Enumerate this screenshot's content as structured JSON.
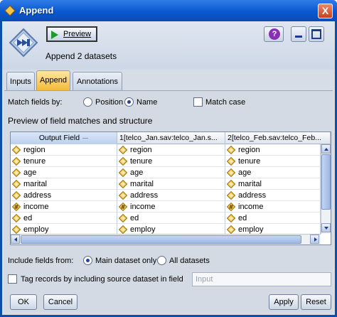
{
  "window": {
    "title": "Append",
    "close_label": "X"
  },
  "toolbar": {
    "preview_label": "Preview",
    "help_label": "?"
  },
  "subtitle": "Append 2 datasets",
  "tabs": [
    {
      "label": "Inputs",
      "active": false
    },
    {
      "label": "Append",
      "active": true
    },
    {
      "label": "Annotations",
      "active": false
    }
  ],
  "match_fields": {
    "label": "Match fields by:",
    "option_position": "Position",
    "option_name": "Name",
    "selected": "Name",
    "match_case_label": "Match case",
    "match_case_checked": false
  },
  "preview_heading": "Preview of field matches and structure",
  "grid": {
    "columns": [
      "Output Field",
      "1[telco_Jan.sav:telco_Jan.s...",
      "2[telco_Feb.sav:telco_Feb..."
    ],
    "rows": [
      {
        "type": "nominal",
        "cells": [
          "region",
          "region",
          "region"
        ]
      },
      {
        "type": "nominal",
        "cells": [
          "tenure",
          "tenure",
          "tenure"
        ]
      },
      {
        "type": "nominal",
        "cells": [
          "age",
          "age",
          "age"
        ]
      },
      {
        "type": "nominal",
        "cells": [
          "marital",
          "marital",
          "marital"
        ]
      },
      {
        "type": "nominal",
        "cells": [
          "address",
          "address",
          "address"
        ]
      },
      {
        "type": "continuous",
        "cells": [
          "income",
          "income",
          "income"
        ]
      },
      {
        "type": "nominal",
        "cells": [
          "ed",
          "ed",
          "ed"
        ]
      },
      {
        "type": "nominal",
        "cells": [
          "employ",
          "employ",
          "employ"
        ]
      }
    ]
  },
  "include_fields": {
    "label": "Include fields from:",
    "option_main": "Main dataset only",
    "option_all": "All datasets",
    "selected": "Main dataset only"
  },
  "tag_records": {
    "label": "Tag records by including source dataset in field",
    "checked": false,
    "field_value": "Input"
  },
  "buttons": {
    "ok": "OK",
    "cancel": "Cancel",
    "apply": "Apply",
    "reset": "Reset"
  },
  "colors": {
    "title_bar": "#0a58d0",
    "active_tab": "#f6b93c",
    "panel": "#d4dae3"
  }
}
